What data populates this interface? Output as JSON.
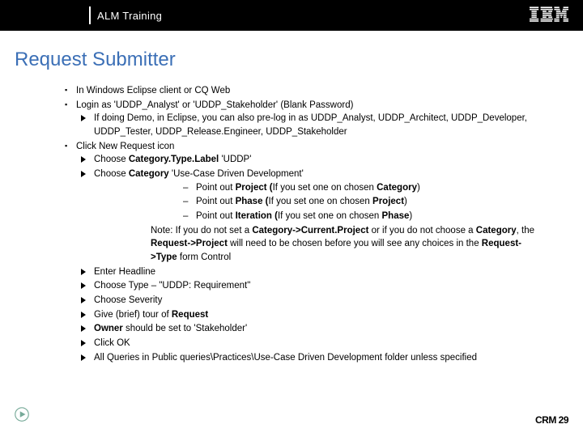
{
  "header": {
    "title": "ALM Training",
    "logo_alt": "IBM"
  },
  "slide": {
    "title": "Request Submitter"
  },
  "b1": "In Windows Eclipse client or CQ Web",
  "b2": "Login as 'UDDP_Analyst' or 'UDDP_Stakeholder' (Blank Password)",
  "b2_1": "If doing Demo, in Eclipse, you can also pre-log in as UDDP_Analyst, UDDP_Architect, UDDP_Developer, UDDP_Tester, UDDP_Release.Engineer, UDDP_Stakeholder",
  "b3": "Click New Request icon",
  "b3_1a": "Choose ",
  "b3_1b": "Category.Type.Label",
  "b3_1c": " 'UDDP'",
  "b3_2a": "Choose ",
  "b3_2b": "Category",
  "b3_2c": " 'Use-Case Driven Development'",
  "p1a": "Point out ",
  "p1b": "Project (",
  "p1c": "If you set one on chosen ",
  "p1d": "Category",
  "p1e": ")",
  "p2a": "Point out ",
  "p2b": "Phase (",
  "p2c": "If you set one on chosen ",
  "p2d": "Project",
  "p2e": ")",
  "p3a": "Point out ",
  "p3b": "Iteration (",
  "p3c": "If you set one on chosen ",
  "p3d": "Phase",
  "p3e": ")",
  "note_a": "Note: If you do not set a ",
  "note_b": "Category->Current.Project",
  "note_c": " or if you do not choose a ",
  "note_d": "Category",
  "note_e": ", the ",
  "note_f": "Request->Project",
  "note_g": " will need to be chosen before you will see any choices in the ",
  "note_h": "Request->Type",
  "note_i": " form Control",
  "b3_3": "Enter Headline",
  "b3_4": "Choose Type – \"UDDP: Requirement\"",
  "b3_5": "Choose Severity",
  "b3_6a": "Give (brief) tour of ",
  "b3_6b": "Request",
  "b3_7a": "Owner",
  "b3_7b": " should be set to 'Stakeholder'",
  "b3_8": "Click OK",
  "b3_9": "All Queries in Public queries\\Practices\\Use-Case Driven Development folder unless specified",
  "footer": {
    "page": "CRM 29"
  }
}
